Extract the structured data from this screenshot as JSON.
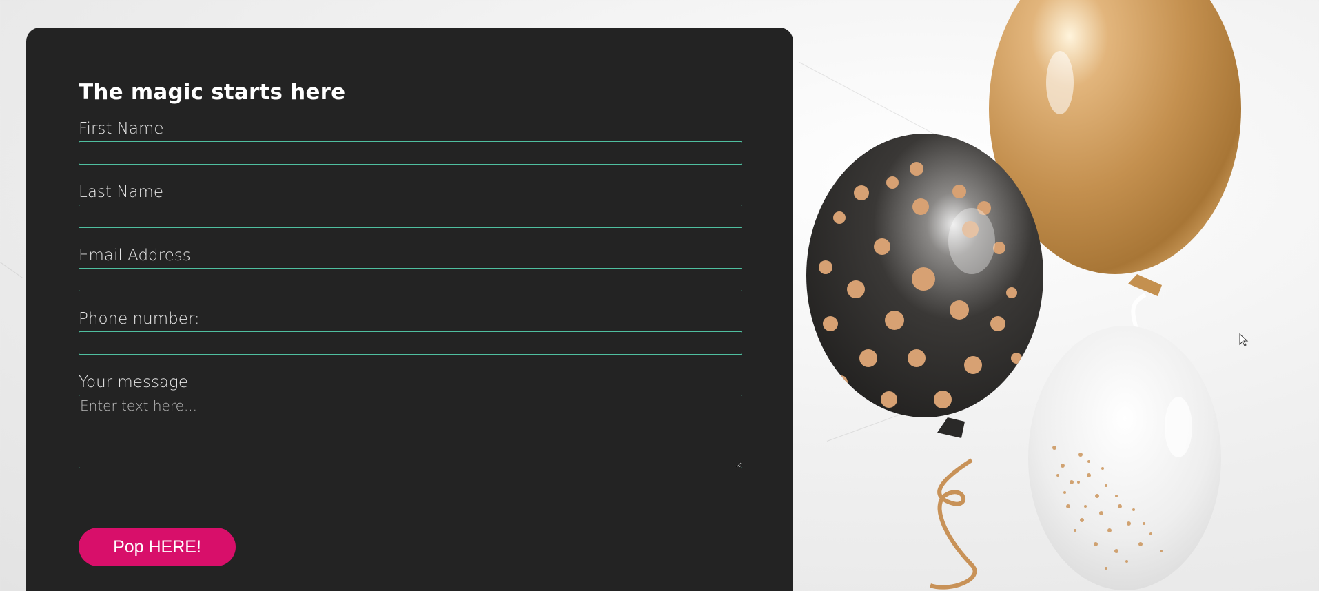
{
  "form": {
    "title": "The magic starts here",
    "fields": [
      {
        "label": "First Name",
        "value": ""
      },
      {
        "label": "Last Name",
        "value": ""
      },
      {
        "label": "Email Address",
        "value": ""
      },
      {
        "label": "Phone number:",
        "value": ""
      }
    ],
    "message": {
      "label": "Your message",
      "placeholder": "Enter text here...",
      "value": ""
    },
    "submit_label": "Pop HERE!"
  },
  "colors": {
    "panel_background": "#232323",
    "input_border": "#4fbf9f",
    "button_background": "#d80f6a",
    "page_background": "#f1f1f1"
  },
  "decor": {
    "balloons": [
      "gold-balloon",
      "black-polka-dot-balloon",
      "clear-confetti-balloon"
    ]
  }
}
